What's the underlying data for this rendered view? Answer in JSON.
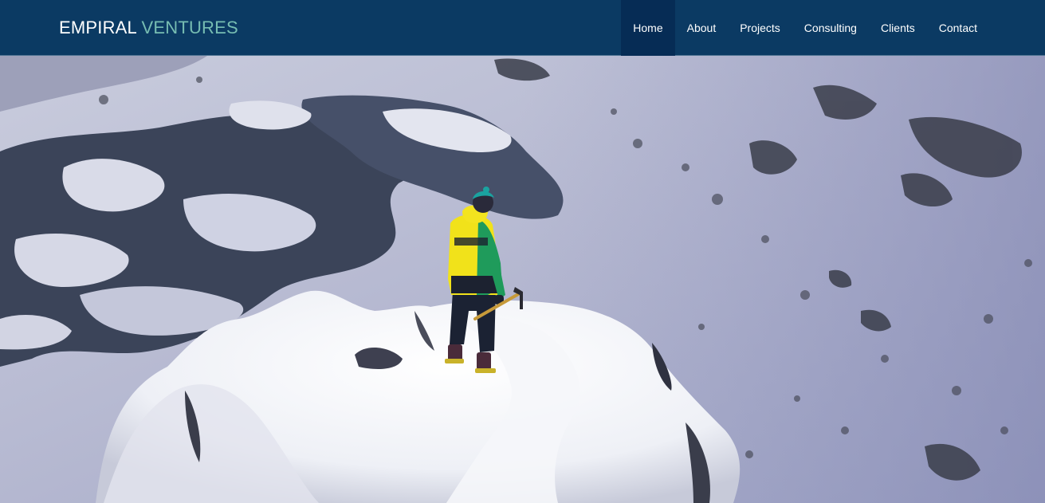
{
  "brand": {
    "part1": "EMPIRAL",
    "part2": "VENTURES"
  },
  "nav": {
    "items": [
      {
        "label": "Home",
        "active": true
      },
      {
        "label": "About"
      },
      {
        "label": "Projects"
      },
      {
        "label": "Consulting"
      },
      {
        "label": "Clients"
      },
      {
        "label": "Contact"
      }
    ]
  },
  "colors": {
    "navbar_bg": "#0b3a63",
    "nav_active_bg": "#062c55",
    "brand_accent": "#77bdb2"
  },
  "hero": {
    "image_subject": "mountaineer-on-snowy-summit-icon"
  }
}
